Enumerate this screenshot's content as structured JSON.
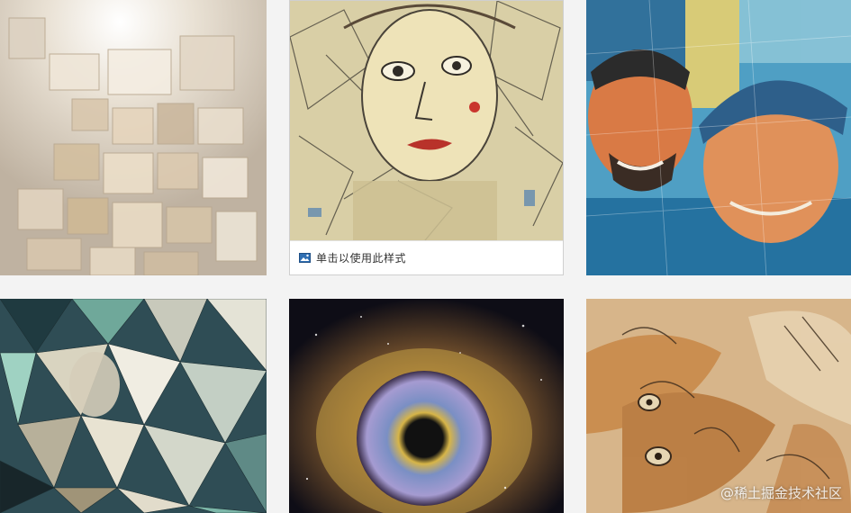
{
  "gallery": {
    "tiles": [
      {
        "style": "cubist-blocks",
        "colors": [
          "#e7ddd0",
          "#cdbba6",
          "#f5f0e8"
        ]
      },
      {
        "style": "kandinsky-sketch",
        "colors": [
          "#e9dcae",
          "#5b5448",
          "#c2a76a"
        ]
      },
      {
        "style": "mosaic-watercolor",
        "colors": [
          "#1f73a5",
          "#e0794a",
          "#8bc3d3"
        ]
      },
      {
        "style": "low-poly",
        "colors": [
          "#2c4a52",
          "#9dd1c0",
          "#d6d8cc"
        ]
      },
      {
        "style": "galaxy-eye",
        "colors": [
          "#1a1a2e",
          "#c29a3c",
          "#8aa9d6"
        ]
      },
      {
        "style": "textured-cat",
        "colors": [
          "#c98a4a",
          "#e8d3b2",
          "#6f4a2a"
        ]
      }
    ],
    "hover_caption": "单击以使用此样式"
  },
  "watermark": "@稀土掘金技术社区"
}
